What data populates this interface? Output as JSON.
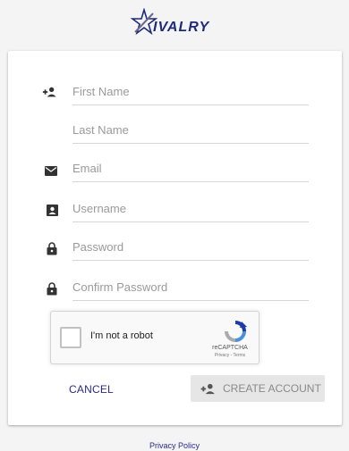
{
  "brand": {
    "logo_text": "IVALRY"
  },
  "form": {
    "first_name": "First Name",
    "last_name": "Last Name",
    "email": "Email",
    "username": "Username",
    "password": "Password",
    "confirm_password": "Confirm Password"
  },
  "captcha": {
    "label": "I'm not a robot",
    "brand": "reCAPTCHA",
    "links": "Privacy - Terms"
  },
  "actions": {
    "cancel": "CANCEL",
    "create": "CREATE ACCOUNT"
  },
  "footer": {
    "privacy": "Privacy Policy"
  },
  "colors": {
    "brand_blue": "#1f2a7a",
    "link": "#2a2a8a",
    "icon": "#333333"
  },
  "icons": [
    "add-person-icon",
    "mail-icon",
    "contact-card-icon",
    "lock-icon",
    "recaptcha-icon"
  ]
}
